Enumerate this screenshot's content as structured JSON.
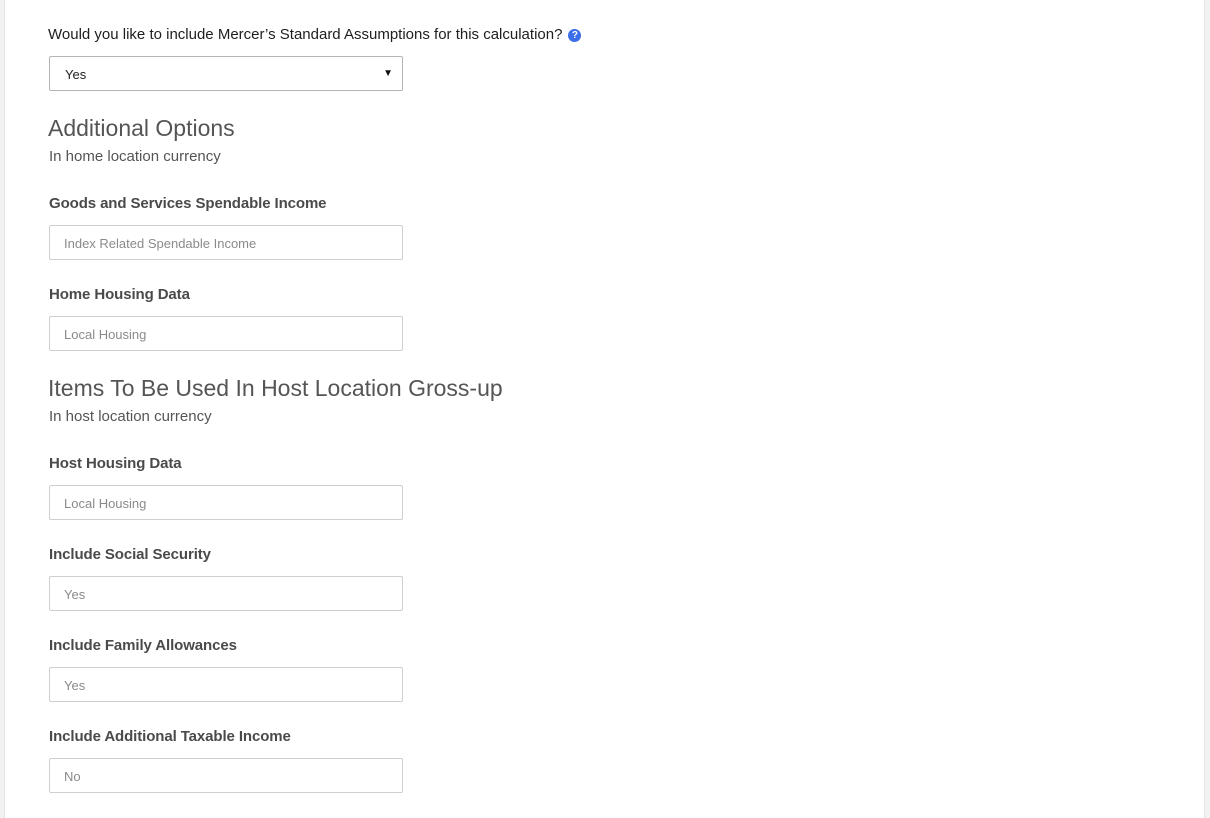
{
  "assumptions": {
    "question": "Would you like to include Mercer’s Standard Assumptions for this calculation?",
    "help_icon": "help-circle-icon",
    "selected": "Yes",
    "caret_icon": "▼"
  },
  "additional_options": {
    "title": "Additional Options",
    "subtitle": "In home location currency",
    "fields": [
      {
        "label": "Goods and Services Spendable Income",
        "value": "Index Related Spendable Income"
      },
      {
        "label": "Home Housing Data",
        "value": "Local Housing"
      }
    ]
  },
  "host_grossup": {
    "title": "Items To Be Used In Host Location Gross-up",
    "subtitle": "In host location currency",
    "fields": [
      {
        "label": "Host Housing Data",
        "value": "Local Housing"
      },
      {
        "label": "Include Social Security",
        "value": "Yes"
      },
      {
        "label": "Include Family Allowances",
        "value": "Yes"
      },
      {
        "label": "Include Additional Taxable Income",
        "value": "No"
      }
    ]
  },
  "colors": {
    "help_icon": "#3b6ee8",
    "heading": "#555555",
    "input_border": "#cfcfcf"
  }
}
